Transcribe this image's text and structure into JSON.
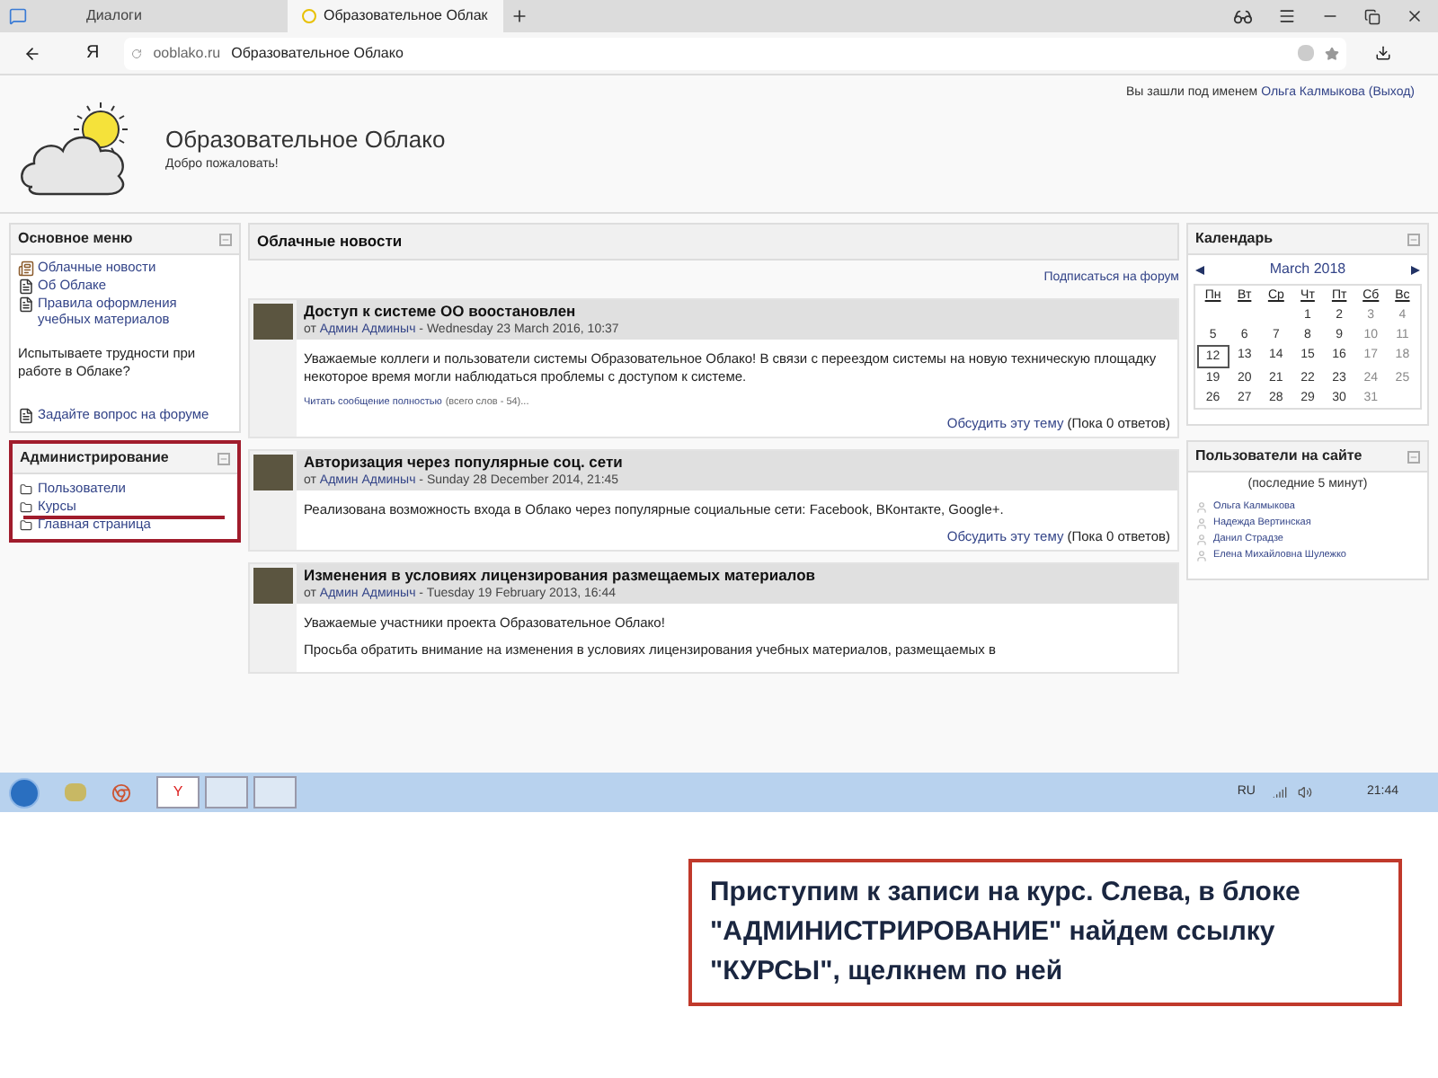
{
  "browser": {
    "tabs": [
      {
        "title": "Диалоги",
        "selected": false
      },
      {
        "title": "Образовательное Облак",
        "selected": true
      }
    ],
    "address": {
      "domain": "ooblako.ru",
      "title": "Образовательное Облако"
    },
    "logo_letter": "Я"
  },
  "header": {
    "login_prefix": "Вы зашли под именем",
    "login_user": "Ольга Калмыкова",
    "logout": "(Выход)",
    "site_title": "Образовательное Облако",
    "welcome": "Добро пожаловать!"
  },
  "main_menu": {
    "title": "Основное меню",
    "items": [
      {
        "label": "Облачные новости",
        "kind": "news"
      },
      {
        "label": "Об Облаке",
        "kind": "page"
      },
      {
        "label": "Правила оформления учебных материалов",
        "kind": "page"
      }
    ],
    "note": "Испытываете трудности при работе в Облаке?",
    "forum_link": "Задайте вопрос на форуме"
  },
  "admin": {
    "title": "Администрирование",
    "highlighted": true,
    "items": [
      {
        "label": "Пользователи",
        "underlined": false
      },
      {
        "label": "Курсы",
        "underlined": true
      },
      {
        "label": "Главная страница",
        "underlined": false
      }
    ]
  },
  "news": {
    "title": "Облачные новости",
    "subscribe": "Подписаться на форум",
    "posts": [
      {
        "title": "Доступ к системе ОО воостановлен",
        "by": "от",
        "author": "Админ Админыч",
        "date": " - Wednesday 23 March 2016, 10:37",
        "paragraphs": [
          "Уважаемые коллеги и пользователи системы Образовательное Облако! В связи с переездом системы на новую техническую площадку некоторое время могли наблюдаться проблемы с доступом к системе."
        ],
        "read_more": "Читать сообщение полностью",
        "word_count": "(всего слов - 54)...",
        "discuss": "Обсудить эту тему",
        "replies": "(Пока 0 ответов)"
      },
      {
        "title": "Авторизация через популярные соц. сети",
        "by": "от",
        "author": "Админ Админыч",
        "date": " - Sunday 28 December 2014, 21:45",
        "paragraphs": [
          "Реализована возможность входа в Облако через популярные социальные сети: Facebook, ВКонтакте, Google+."
        ],
        "discuss": "Обсудить эту тему",
        "replies": "(Пока 0 ответов)"
      },
      {
        "title": "Изменения в условиях лицензирования размещаемых материалов",
        "by": "от",
        "author": "Админ Админыч",
        "date": " - Tuesday 19 February 2013, 16:44",
        "paragraphs": [
          "Уважаемые участники проекта Образовательное Облако!",
          "Просьба обратить внимание на изменения в условиях лицензирования учебных материалов, размещаемых в"
        ]
      }
    ]
  },
  "calendar": {
    "title": "Календарь",
    "month": "March 2018",
    "weekdays": [
      "Пн",
      "Вт",
      "Ср",
      "Чт",
      "Пт",
      "Сб",
      "Вс"
    ],
    "weeks": [
      [
        {
          "day": "1",
          "selected": false
        },
        {
          "day": "2",
          "selected": false
        },
        {
          "day": "3",
          "selected": false
        },
        {
          "day": "4",
          "selected": false
        }
      ],
      [
        {
          "day": "5",
          "selected": false
        },
        {
          "day": "6",
          "selected": false
        },
        {
          "day": "7",
          "selected": false
        },
        {
          "day": "8",
          "selected": false
        },
        {
          "day": "9",
          "selected": false
        },
        {
          "day": "10",
          "selected": false
        },
        {
          "day": "11",
          "selected": false
        }
      ],
      [
        {
          "day": "12",
          "selected": true
        },
        {
          "day": "13",
          "selected": false
        },
        {
          "day": "14",
          "selected": false
        },
        {
          "day": "15",
          "selected": false
        },
        {
          "day": "16",
          "selected": false
        },
        {
          "day": "17",
          "selected": false
        },
        {
          "day": "18",
          "selected": false
        }
      ],
      [
        {
          "day": "19",
          "selected": false
        },
        {
          "day": "20",
          "selected": false
        },
        {
          "day": "21",
          "selected": false
        },
        {
          "day": "22",
          "selected": false
        },
        {
          "day": "23",
          "selected": false
        },
        {
          "day": "24",
          "selected": false
        },
        {
          "day": "25",
          "selected": false
        }
      ],
      [
        {
          "day": "26",
          "selected": false
        },
        {
          "day": "27",
          "selected": false
        },
        {
          "day": "28",
          "selected": false
        },
        {
          "day": "29",
          "selected": false
        },
        {
          "day": "30",
          "selected": false
        },
        {
          "day": "31",
          "selected": false
        }
      ]
    ]
  },
  "online": {
    "title": "Пользователи на сайте",
    "period": "(последние 5 минут)",
    "users": [
      "Ольга Калмыкова",
      "Надежда Вертинская",
      "Данил Страдзе",
      "Елена Михайловна Шулежко"
    ]
  },
  "taskbar": {
    "browser_letter": "Y",
    "language": "RU",
    "time": "21:44"
  },
  "caption": "Приступим к записи на курс. Слева, в блоке \"АДМИНИСТРИРОВАНИЕ\" найдем ссылку \"КУРСЫ\", щелкнем по ней"
}
